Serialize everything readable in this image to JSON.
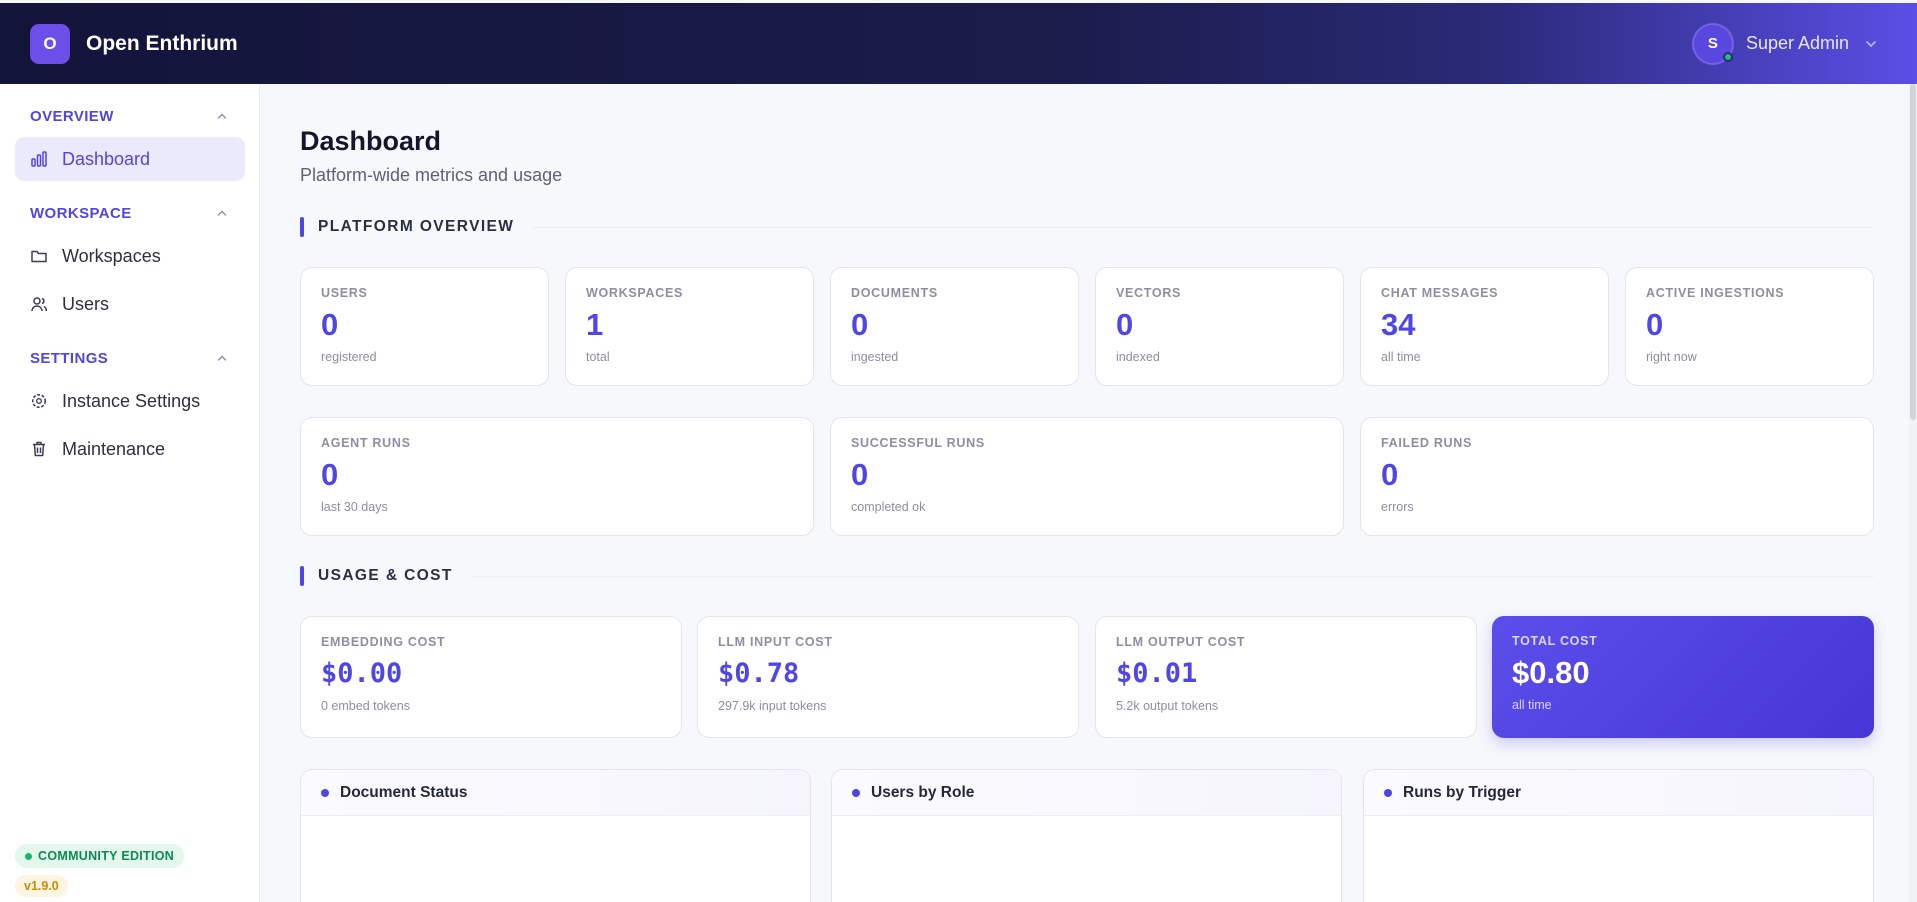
{
  "brand": {
    "logo_letter": "O",
    "name": "Open Enthrium"
  },
  "user": {
    "initial": "S",
    "name": "Super Admin"
  },
  "sidebar": {
    "sections": [
      {
        "title": "OVERVIEW",
        "items": [
          {
            "label": "Dashboard",
            "icon": "bar-chart-icon",
            "active": true
          }
        ]
      },
      {
        "title": "WORKSPACE",
        "items": [
          {
            "label": "Workspaces",
            "icon": "folder-icon"
          },
          {
            "label": "Users",
            "icon": "users-icon"
          }
        ]
      },
      {
        "title": "SETTINGS",
        "items": [
          {
            "label": "Instance Settings",
            "icon": "gear-icon"
          },
          {
            "label": "Maintenance",
            "icon": "trash-icon"
          }
        ]
      }
    ],
    "edition": "COMMUNITY EDITION",
    "version": "v1.9.0"
  },
  "page": {
    "title": "Dashboard",
    "subtitle": "Platform-wide metrics and usage"
  },
  "platform_overview": {
    "title": "PLATFORM OVERVIEW",
    "row1": [
      {
        "label": "USERS",
        "value": "0",
        "sub": "registered"
      },
      {
        "label": "WORKSPACES",
        "value": "1",
        "sub": "total"
      },
      {
        "label": "DOCUMENTS",
        "value": "0",
        "sub": "ingested"
      },
      {
        "label": "VECTORS",
        "value": "0",
        "sub": "indexed"
      },
      {
        "label": "CHAT MESSAGES",
        "value": "34",
        "sub": "all time"
      },
      {
        "label": "ACTIVE INGESTIONS",
        "value": "0",
        "sub": "right now"
      }
    ],
    "row2": [
      {
        "label": "AGENT RUNS",
        "value": "0",
        "sub": "last 30 days"
      },
      {
        "label": "SUCCESSFUL RUNS",
        "value": "0",
        "sub": "completed ok"
      },
      {
        "label": "FAILED RUNS",
        "value": "0",
        "sub": "errors"
      }
    ]
  },
  "usage_cost": {
    "title": "USAGE & COST",
    "cards": [
      {
        "label": "EMBEDDING COST",
        "value": "$0.00",
        "sub": "0 embed tokens"
      },
      {
        "label": "LLM INPUT COST",
        "value": "$0.78",
        "sub": "297.9k input tokens"
      },
      {
        "label": "LLM OUTPUT COST",
        "value": "$0.01",
        "sub": "5.2k output tokens"
      },
      {
        "label": "TOTAL COST",
        "value": "$0.80",
        "sub": "all time"
      }
    ]
  },
  "panels": [
    "Document Status",
    "Users by Role",
    "Runs by Trigger"
  ],
  "colors": {
    "accent": "#4f46e5",
    "topbar_dark": "#13143a",
    "topbar_light": "#5b4ee6",
    "success": "#14b86b",
    "version": "#c98a08"
  }
}
